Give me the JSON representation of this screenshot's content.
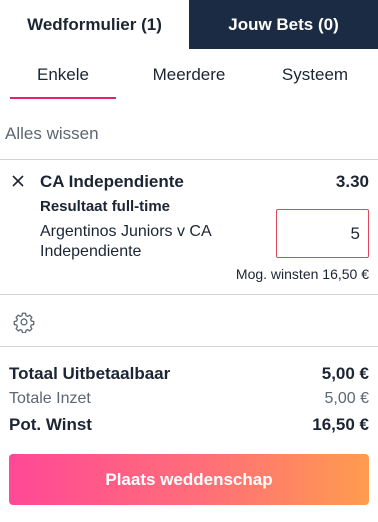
{
  "tabs": {
    "betslip": "Wedformulier (1)",
    "my_bets": "Jouw Bets (0)"
  },
  "subtabs": [
    "Enkele",
    "Meerdere",
    "Systeem"
  ],
  "clear_all": "Alles wissen",
  "bet": {
    "selection": "CA Independiente",
    "odds": "3.30",
    "market": "Resultaat full-time",
    "event": "Argentinos Juniors v CA Independiente",
    "stake": "5",
    "potential_label": "Mog. winsten",
    "potential_value": "16,50 €"
  },
  "summary": {
    "total_payout_label": "Totaal Uitbetaalbaar",
    "total_payout_value": "5,00 €",
    "total_stake_label": "Totale Inzet",
    "total_stake_value": "5,00 €",
    "pot_win_label": "Pot. Winst",
    "pot_win_value": "16,50 €"
  },
  "place_bet_label": "Plaats weddenschap",
  "colors": {
    "navy": "#1c2b44",
    "accent": "#e0246a",
    "input_border": "#e0495a",
    "gradient_start": "#ff4896",
    "gradient_end": "#ff9c4f"
  },
  "icons": {
    "remove": "close-icon",
    "settings": "gear-icon"
  }
}
